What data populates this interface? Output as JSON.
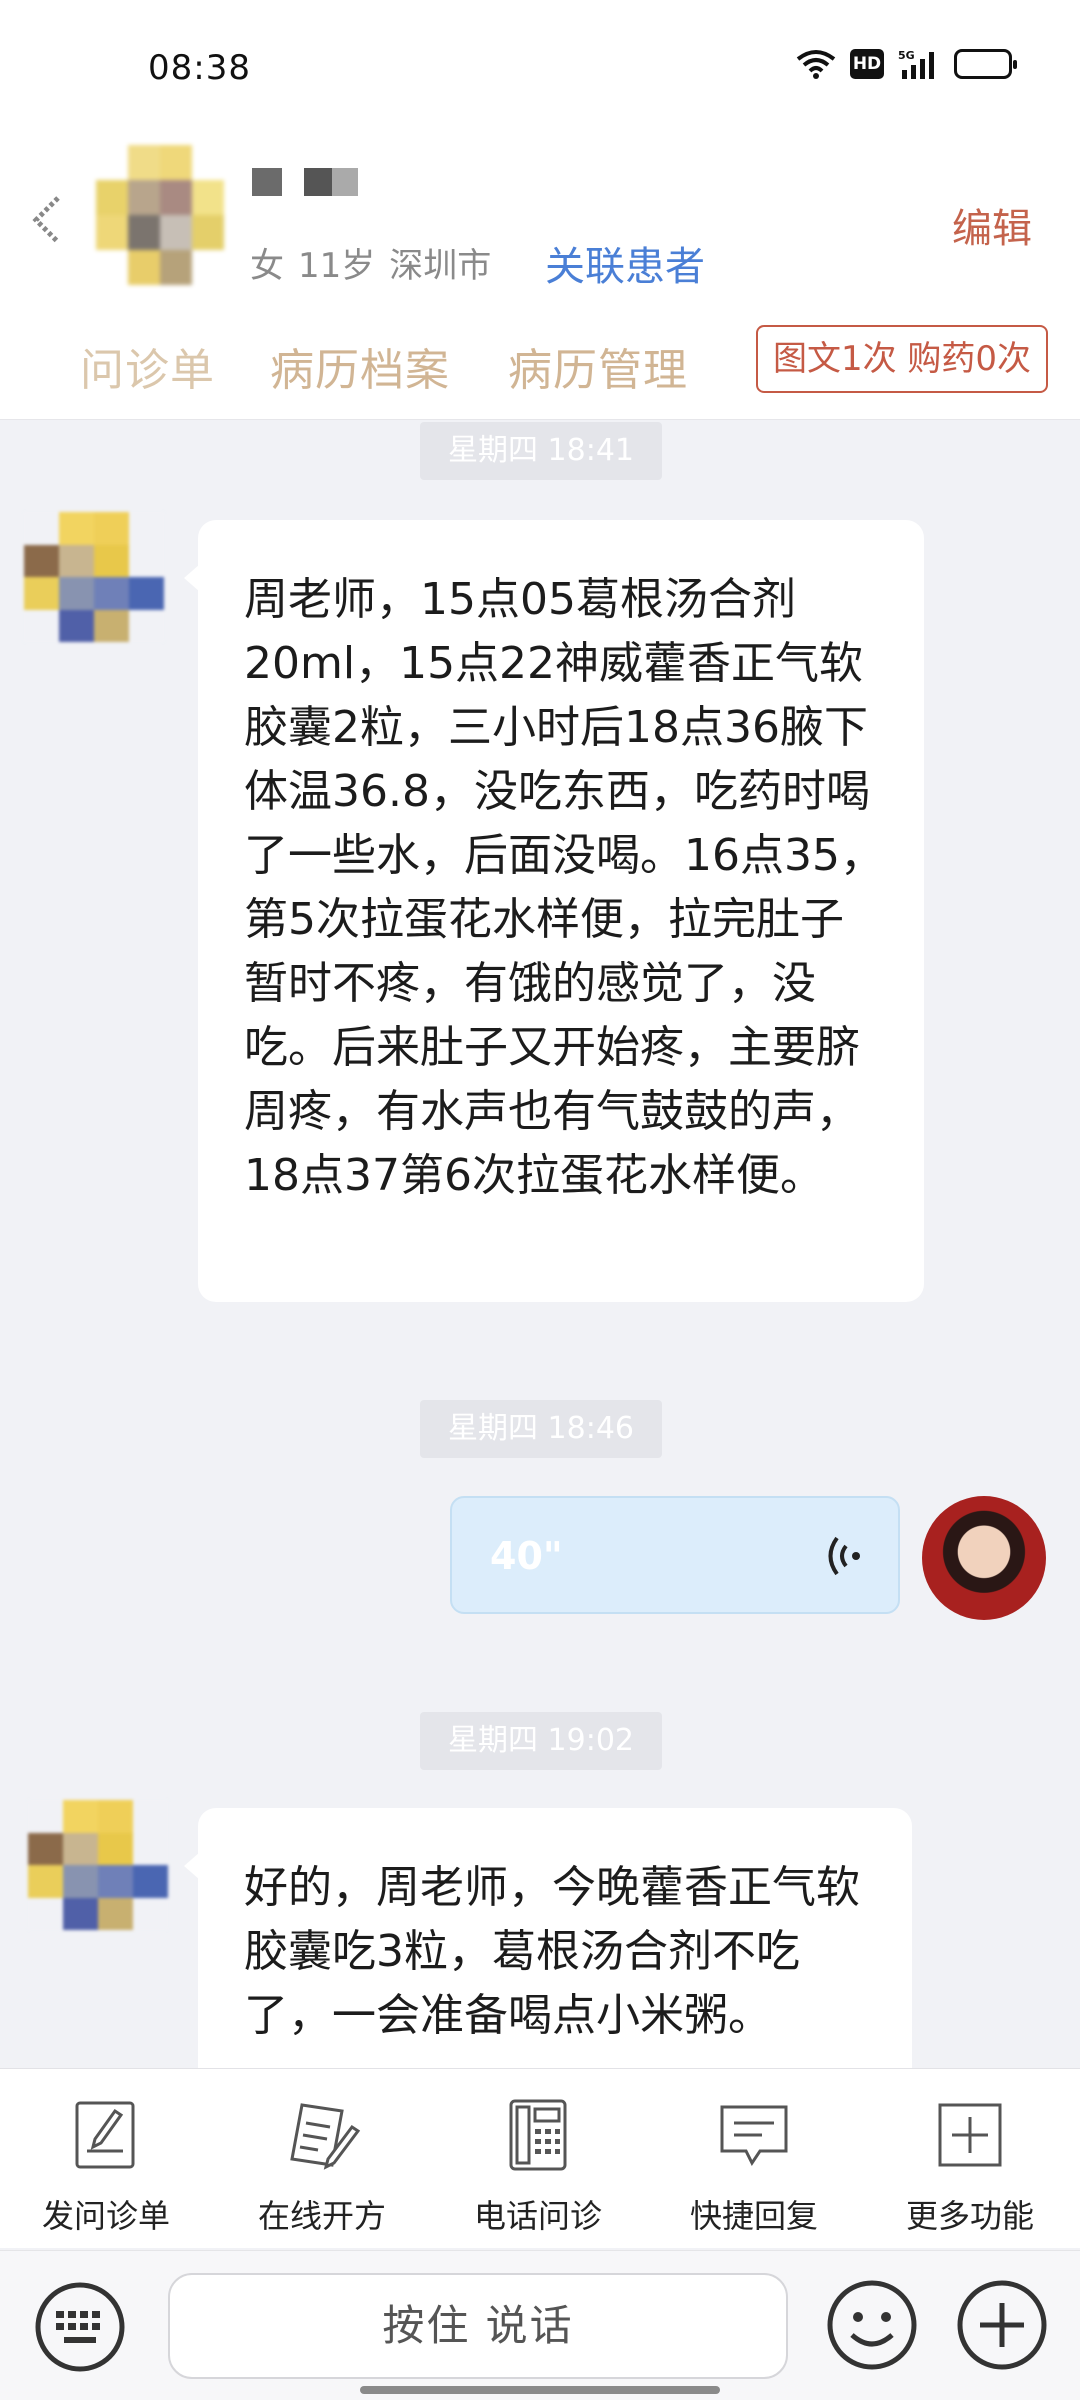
{
  "status_bar": {
    "time": "08:38",
    "hd": "HD",
    "network": "5G"
  },
  "header": {
    "patient_gender": "女",
    "patient_age": "11岁",
    "patient_city": "深圳市",
    "link_patient_label": "关联患者",
    "edit_label": "编辑",
    "tabs": [
      "问诊单",
      "病历档案",
      "病历管理"
    ],
    "consult_badge": "图文1次 购药0次"
  },
  "messages": [
    {
      "time": "星期四 18:41",
      "sender": "patient",
      "text": "周老师，15点05葛根汤合剂20ml，15点22神威藿香正气软胶囊2粒，三小时后18点36腋下体温36.8，没吃东西，吃药时喝了一些水，后面没喝。16点35，第5次拉蛋花水样便，拉完肚子暂时不疼，有饿的感觉了，没吃。后来肚子又开始疼，主要脐周疼，有水声也有气鼓鼓的声，18点37第6次拉蛋花水样便。"
    },
    {
      "time": "星期四 18:46",
      "sender": "doctor",
      "voice_duration": "40\""
    },
    {
      "time": "星期四 19:02",
      "sender": "patient",
      "text": "好的，周老师，今晚藿香正气软胶囊吃3粒，葛根汤合剂不吃了，一会准备喝点小米粥。"
    }
  ],
  "toolbar": {
    "items": [
      {
        "label": "发问诊单",
        "icon": "form-icon"
      },
      {
        "label": "在线开方",
        "icon": "prescription-icon"
      },
      {
        "label": "电话问诊",
        "icon": "phone-icon"
      },
      {
        "label": "快捷回复",
        "icon": "quick-reply-icon"
      },
      {
        "label": "更多功能",
        "icon": "more-icon"
      }
    ]
  },
  "input_bar": {
    "hold_to_talk": "按住 说话"
  },
  "colors": {
    "accent_blue": "#4a7fd6",
    "edit_red": "#c4634c",
    "tab_gold": "#d1b594",
    "voice_bubble": "#dcedfb",
    "background": "#f1f2f6"
  }
}
